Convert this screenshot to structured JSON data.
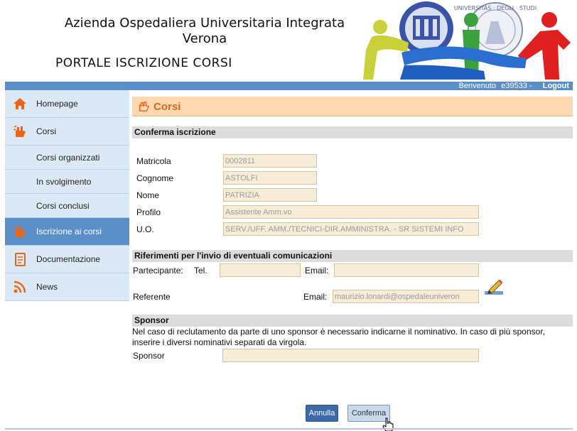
{
  "header": {
    "org_line1": "Azienda Ospedaliera Universitaria Integrata",
    "org_line2": "Verona",
    "portal_title": "PORTALE ISCRIZIONE CORSI",
    "logo_text": "UNIVERSITAS · DEGLI · STUDI"
  },
  "topbar": {
    "welcome": "Benvenuto",
    "user": "e39533 -",
    "logout": "Logout"
  },
  "sidebar": {
    "items": [
      {
        "label": "Homepage",
        "icon": "home-icon"
      },
      {
        "label": "Corsi",
        "icon": "hand-icon"
      },
      {
        "label": "Corsi organizzati"
      },
      {
        "label": "In svolgimento"
      },
      {
        "label": "Corsi conclusi"
      },
      {
        "label": "Iscrizione ai corsi",
        "icon": "hand-icon",
        "active": true
      },
      {
        "label": "Documentazione",
        "icon": "document-icon"
      },
      {
        "label": "News",
        "icon": "rss-icon"
      }
    ]
  },
  "page": {
    "title": "Corsi",
    "section_confirm": "Conferma iscrizione",
    "fields": {
      "matricola": {
        "label": "Matricola",
        "value": "0002811"
      },
      "cognome": {
        "label": "Cognome",
        "value": "ASTOLFI"
      },
      "nome": {
        "label": "Nome",
        "value": "PATRIZIA"
      },
      "profilo": {
        "label": "Profilo",
        "value": "Assistente Amm.vo"
      },
      "uo": {
        "label": "U.O.",
        "value": "SERV./UFF. AMM./TECNICI-DIR.AMMINISTRA. - SR SISTEMI INFO"
      }
    },
    "section_refs": "Riferimenti per l'invio di eventuali comunicazioni",
    "partecipante_label": "Partecipante:",
    "tel_label": "Tel.",
    "tel_value": "",
    "email_label": "Email:",
    "email_value": "",
    "referente_label": "Referente",
    "referente_email_label": "Email:",
    "referente_email_value": "maurizio.lonardi@ospedaleuniveron",
    "section_sponsor": "Sponsor",
    "sponsor_note": "Nel caso di reclutamento da parte di uno sponsor è necessario indicarne il nominativo. In caso di più sponsor, inserire i diversi nominativi separati da virgola.",
    "sponsor_label": "Sponsor",
    "sponsor_value": "",
    "cancel_label": "Annulla",
    "confirm_label": "Conferma"
  },
  "colors": {
    "accent_blue": "#5b8fc9",
    "heading_orange": "#e8651a",
    "heading_bg": "#fcd9b1",
    "input_bg": "#f7ecd8"
  }
}
